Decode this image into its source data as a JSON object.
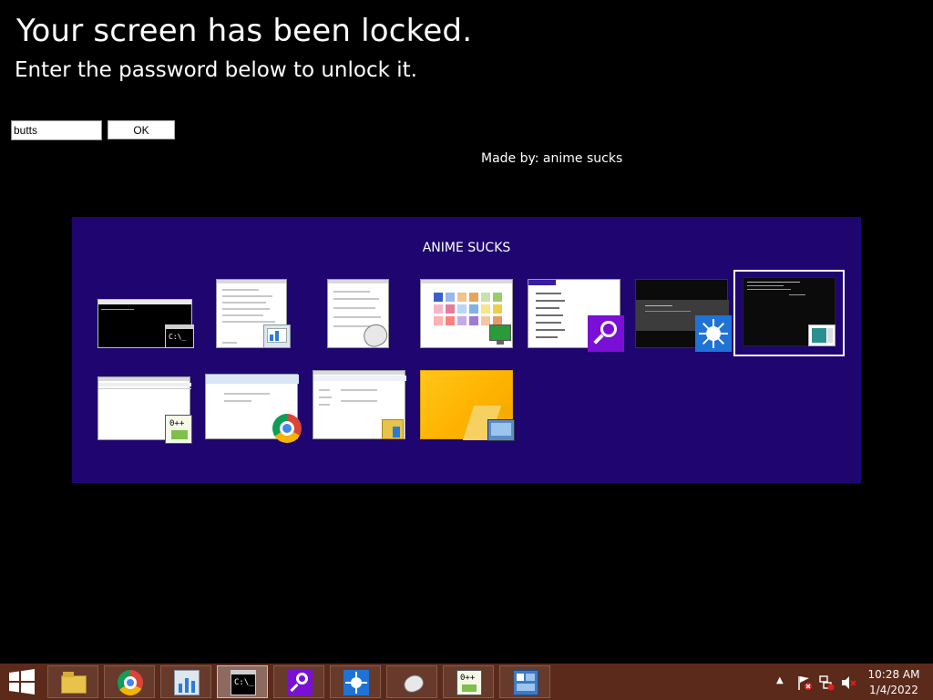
{
  "lock": {
    "title": "Your screen has been locked.",
    "subtitle": "Enter the password below to unlock it.",
    "password_value": "butts",
    "ok_label": "OK",
    "credit": "Made by: anime sucks"
  },
  "switcher": {
    "title": "ANIME SUCKS",
    "windows": [
      {
        "name": "command-prompt",
        "icon": "cmd-icon"
      },
      {
        "name": "task-manager",
        "icon": "task-manager-icon"
      },
      {
        "name": "mouse-properties",
        "icon": "mouse-icon"
      },
      {
        "name": "color-picker",
        "icon": "display-icon"
      },
      {
        "name": "search",
        "icon": "search-icon"
      },
      {
        "name": "brightness",
        "icon": "brightness-icon"
      },
      {
        "name": "console-app",
        "icon": "window-icon",
        "selected": true
      },
      {
        "name": "notepad-plus-plus",
        "icon": "notepad-icon"
      },
      {
        "name": "chrome",
        "icon": "chrome-icon"
      },
      {
        "name": "file-explorer",
        "icon": "folder-icon"
      },
      {
        "name": "desktop",
        "icon": "desktop-icon"
      }
    ]
  },
  "taskbar": {
    "items": [
      {
        "name": "file-explorer",
        "icon": "folder-icon"
      },
      {
        "name": "chrome",
        "icon": "chrome-icon"
      },
      {
        "name": "task-manager",
        "icon": "task-manager-icon"
      },
      {
        "name": "command-prompt",
        "icon": "cmd-icon",
        "active": true
      },
      {
        "name": "search",
        "icon": "search-icon"
      },
      {
        "name": "brightness",
        "icon": "brightness-icon"
      },
      {
        "name": "mouse-properties",
        "icon": "mouse-icon"
      },
      {
        "name": "notepad-plus-plus",
        "icon": "notepad-icon"
      },
      {
        "name": "control-panel",
        "icon": "control-panel-icon"
      }
    ],
    "time": "10:28 AM",
    "date": "1/4/2022"
  },
  "colors": {
    "background": "#000000",
    "switcher_bg": "#1e0570",
    "taskbar_bg": "#5b2a1a",
    "accent_purple": "#7a0fd6",
    "accent_blue": "#1f73d6"
  }
}
